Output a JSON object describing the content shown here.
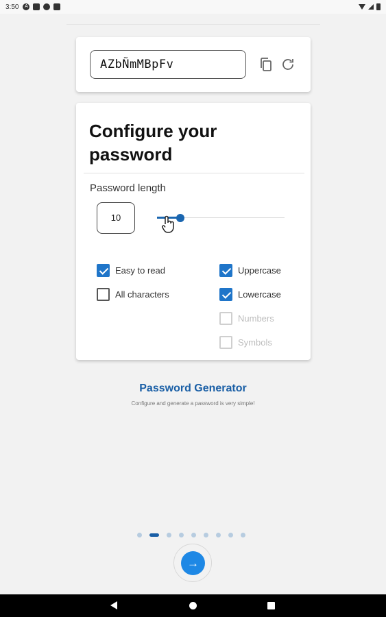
{
  "status_bar": {
    "time": "3:50",
    "icons_left": [
      "a-icon",
      "sim-icon",
      "sync-icon",
      "storage-icon"
    ],
    "icons_right": [
      "wifi-icon",
      "signal-icon",
      "battery-icon"
    ]
  },
  "password": {
    "value": "AZbÑmMBpFv",
    "copy_icon": "copy-icon",
    "refresh_icon": "refresh-icon"
  },
  "config": {
    "title": "Configure your password",
    "length_label": "Password length",
    "length_value": "10",
    "slider": {
      "min": 1,
      "max": 50,
      "value": 10,
      "accent": "#1a66b0"
    },
    "options": [
      {
        "key": "easy_to_read",
        "label": "Easy to read",
        "checked": true,
        "enabled": true
      },
      {
        "key": "all_characters",
        "label": "All characters",
        "checked": false,
        "enabled": true
      },
      {
        "key": "uppercase",
        "label": "Uppercase",
        "checked": true,
        "enabled": true
      },
      {
        "key": "lowercase",
        "label": "Lowercase",
        "checked": true,
        "enabled": true
      },
      {
        "key": "numbers",
        "label": "Numbers",
        "checked": false,
        "enabled": false
      },
      {
        "key": "symbols",
        "label": "Symbols",
        "checked": false,
        "enabled": false
      }
    ]
  },
  "onboarding": {
    "title": "Password Generator",
    "subtitle": "Configure and generate a password is very simple!",
    "page_count": 9,
    "active_page": 2,
    "next_icon": "arrow-right-icon",
    "next_glyph": "→"
  },
  "colors": {
    "accent": "#1e88e5",
    "title_blue": "#1a5fa6",
    "checkbox_blue": "#1f75c9"
  }
}
